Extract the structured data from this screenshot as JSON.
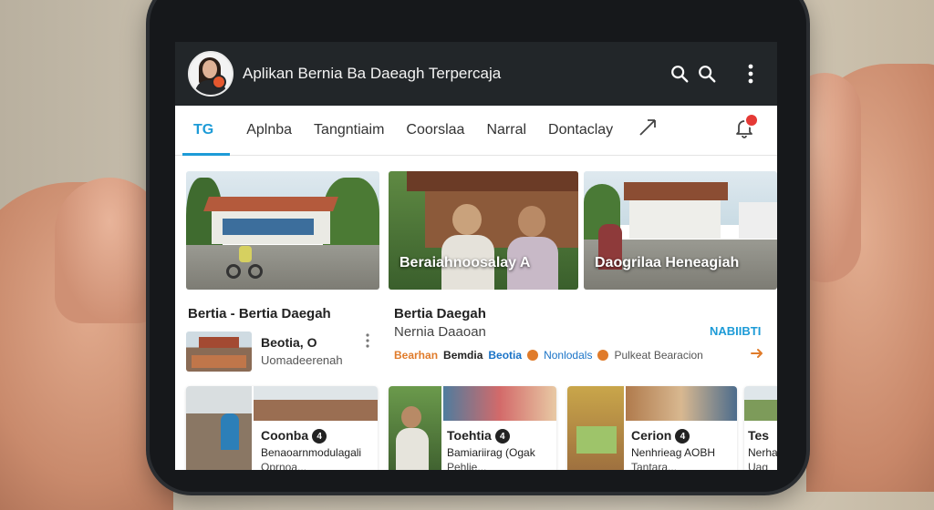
{
  "app": {
    "title": "Aplikan Bernia Ba Daeagh Terpercaja"
  },
  "tabs": [
    {
      "label": "TG",
      "active": true
    },
    {
      "label": "Aplnba",
      "active": false
    },
    {
      "label": "Tangntiaim",
      "active": false
    },
    {
      "label": "Coorslaa",
      "active": false
    },
    {
      "label": "Narral",
      "active": false
    },
    {
      "label": "Dontaclay",
      "active": false
    }
  ],
  "hero": {
    "captions": [
      "Beraiahnoosalay A",
      "Daogrilaa Heneagiah"
    ]
  },
  "section_left": {
    "title": "Bertia - Bertia Daegah",
    "item_title": "Beotia, O",
    "item_subtitle": "Uomadeerenah"
  },
  "section_right": {
    "title": "Bertia Daegah",
    "subtitle": "Nernia Daaoan",
    "more_label": "NABIIBTI",
    "tags": [
      "Bearhan",
      "Bemdia",
      "Beotia",
      "Nonlodals",
      "Pulkeat Bearacion"
    ]
  },
  "cards": [
    {
      "title": "Coonba",
      "line1": "Benaoarnmodulagali",
      "line2": "Oprnoa..."
    },
    {
      "title": "Toehtia",
      "line1": "Bamiariirag (Ogak",
      "line2": "Pehlie..."
    },
    {
      "title": "Cerion",
      "line1": "Nenhrieag AOBH",
      "line2": "Tantara..."
    },
    {
      "title": "Tes",
      "line1": "Nerha",
      "line2": "Uag"
    }
  ],
  "colors": {
    "accent": "#1d9bd7",
    "appbar": "#222629",
    "notification": "#e53935",
    "tag_orange": "#e07b2a",
    "tag_blue": "#1a73c7"
  },
  "icons": [
    "search-icon",
    "more-vert-icon",
    "share-icon",
    "bell-icon",
    "arrow-right-icon"
  ]
}
